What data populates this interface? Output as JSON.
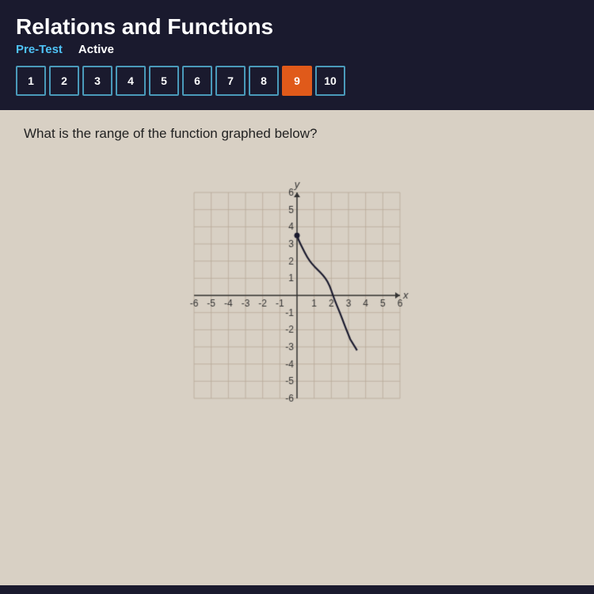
{
  "header": {
    "title": "Relations and Functions",
    "pre_test": "Pre-Test",
    "active": "Active"
  },
  "nav": {
    "buttons": [
      1,
      2,
      3,
      4,
      5,
      6,
      7,
      8,
      9,
      10
    ],
    "active_button": 9
  },
  "question": {
    "text": "What is the range of the function graphed below?"
  },
  "graph": {
    "x_min": -6,
    "x_max": 6,
    "y_min": -6,
    "y_max": 6
  }
}
